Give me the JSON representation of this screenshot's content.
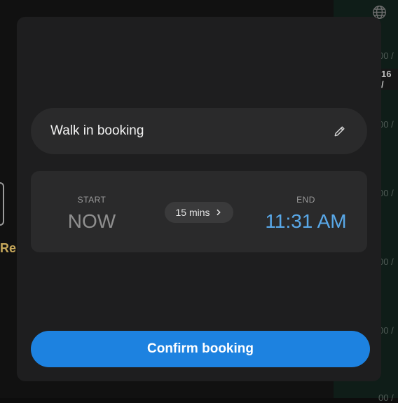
{
  "background": {
    "time_labels": [
      "00 /",
      "16 /",
      "00 /",
      "00 /",
      "00 /",
      "00 /",
      "00 /"
    ],
    "left_fragment_text": "Rep"
  },
  "modal": {
    "title_field": {
      "value": "Walk in booking",
      "edit_icon": "pencil-icon"
    },
    "start": {
      "label": "START",
      "value": "NOW"
    },
    "duration": {
      "label": "15 mins",
      "icon": "chevron-right-icon"
    },
    "end": {
      "label": "END",
      "value": "11:31 AM"
    },
    "confirm_label": "Confirm booking"
  },
  "colors": {
    "accent": "#1d82e0",
    "end_time": "#59a8e8",
    "modal_bg": "#1e1e1f",
    "card_bg": "#2a2a2b"
  }
}
